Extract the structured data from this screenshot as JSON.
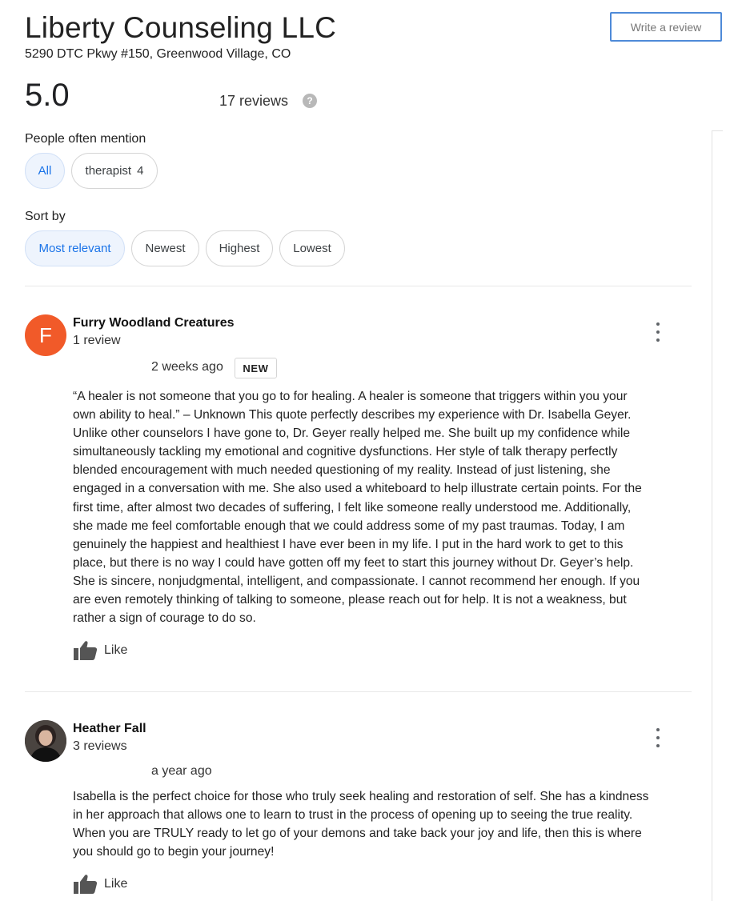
{
  "business": {
    "name": "Liberty Counseling LLC",
    "address": "5290 DTC Pkwy #150, Greenwood Village, CO",
    "write_review_label": "Write a review",
    "rating": "5.0",
    "review_count": "17 reviews",
    "help_icon_glyph": "?"
  },
  "mentions": {
    "label": "People often mention",
    "chips": [
      {
        "label": "All",
        "count": "",
        "selected": true
      },
      {
        "label": "therapist",
        "count": "4",
        "selected": false
      }
    ]
  },
  "sort": {
    "label": "Sort by",
    "options": [
      {
        "label": "Most relevant",
        "selected": true
      },
      {
        "label": "Newest",
        "selected": false
      },
      {
        "label": "Highest",
        "selected": false
      },
      {
        "label": "Lowest",
        "selected": false
      }
    ]
  },
  "reviews": [
    {
      "avatar_letter": "F",
      "avatar_color": "#f15a29",
      "name": "Furry Woodland Creatures",
      "reviewer_count": "1 review",
      "time": "2 weeks ago",
      "badge": "NEW",
      "text_lines": [
        "“A healer is not someone that you go to for healing.  A healer is someone that triggers within you your",
        "own ability to heal.” – Unknown This quote perfectly describes my experience with Dr. Isabella Geyer.",
        "Unlike other counselors I have gone to, Dr. Geyer really helped me.  She built up my confidence while",
        "simultaneously tackling my emotional and cognitive dysfunctions.  Her style of talk therapy perfectly",
        "blended encouragement with much needed questioning of my reality.  Instead of just listening, she",
        "engaged in a conversation with me.  She also used a whiteboard to help illustrate certain points.  For the",
        "first time, after almost two decades of suffering, I felt like someone really understood me.  Additionally,",
        "she made me feel comfortable enough that we could address some of my past traumas.  Today, I am",
        "genuinely the happiest and healthiest I have ever been in my life.  I put in the hard work to get to this",
        "place, but there is no way I could have gotten off my feet to start this journey without Dr. Geyer’s help.",
        "She is sincere, nonjudgmental, intelligent, and compassionate.  I cannot recommend her enough.  If you",
        "are even remotely thinking of talking to someone, please reach out for help.  It is not a weakness, but",
        "rather a sign of courage to do so."
      ],
      "like_label": "Like"
    },
    {
      "avatar_letter": "",
      "name": "Heather Fall",
      "reviewer_count": "3 reviews",
      "time": "a year ago",
      "badge": "",
      "text_lines": [
        "Isabella is the perfect choice for those who truly seek healing and restoration of self. She has a kindness",
        "in her approach that allows one to learn to trust in the process of opening up to seeing the true reality.",
        "When you are TRULY ready to let go of your demons and take back your joy and life, then this is where",
        "you should go to begin your journey!"
      ],
      "like_label": "Like"
    }
  ]
}
